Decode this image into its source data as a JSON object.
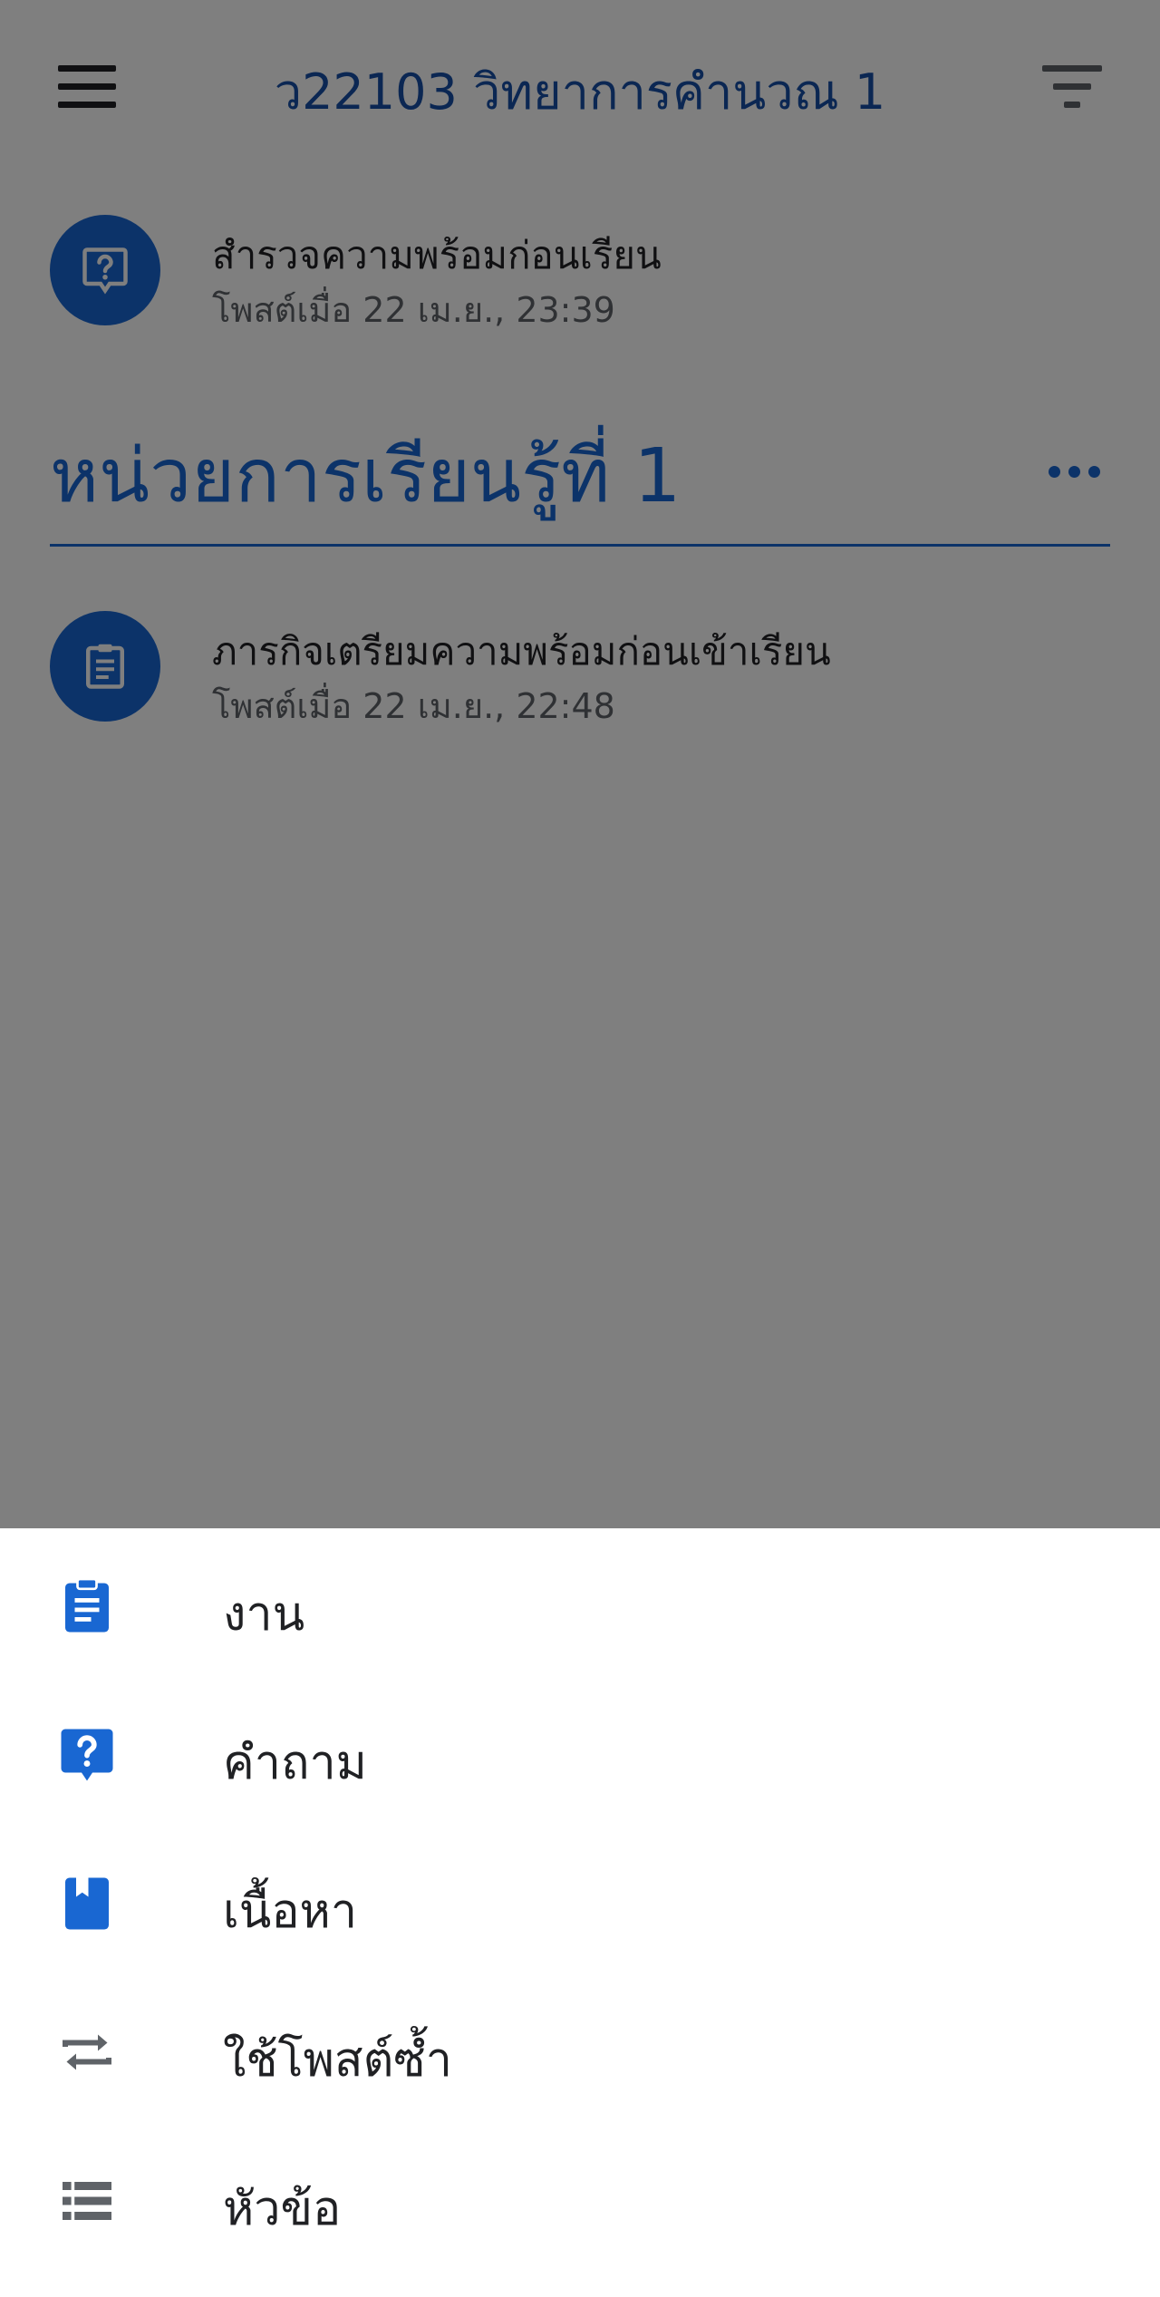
{
  "header": {
    "title": "ว22103 วิทยาการคำนวณ 1",
    "menu_icon": "hamburger-menu-icon",
    "filter_icon": "filter-icon"
  },
  "posts": [
    {
      "title": "สำรวจความพร้อมก่อนเรียน",
      "meta": "โพสต์เมื่อ 22 เม.ย., 23:39",
      "icon": "question-icon"
    }
  ],
  "topic": {
    "title": "หน่วยการเรียนรู้ที่ 1",
    "more_icon": "more-horizontal-icon",
    "posts": [
      {
        "title": "ภารกิจเตรียมความพร้อมก่อนเข้าเรียน",
        "meta": "โพสต์เมื่อ 22 เม.ย., 22:48",
        "icon": "assignment-icon"
      }
    ]
  },
  "create_menu": {
    "items": [
      {
        "label": "งาน",
        "icon": "assignment-icon"
      },
      {
        "label": "คำถาม",
        "icon": "question-icon"
      },
      {
        "label": "เนื้อหา",
        "icon": "material-icon"
      },
      {
        "label": "ใช้โพสต์ซ้ำ",
        "icon": "reuse-post-icon"
      },
      {
        "label": "หัวข้อ",
        "icon": "topic-icon"
      }
    ]
  },
  "colors": {
    "accent": "#1967d2",
    "title_blue": "#174ea6",
    "scrim": "rgba(0,0,0,0.5)"
  }
}
